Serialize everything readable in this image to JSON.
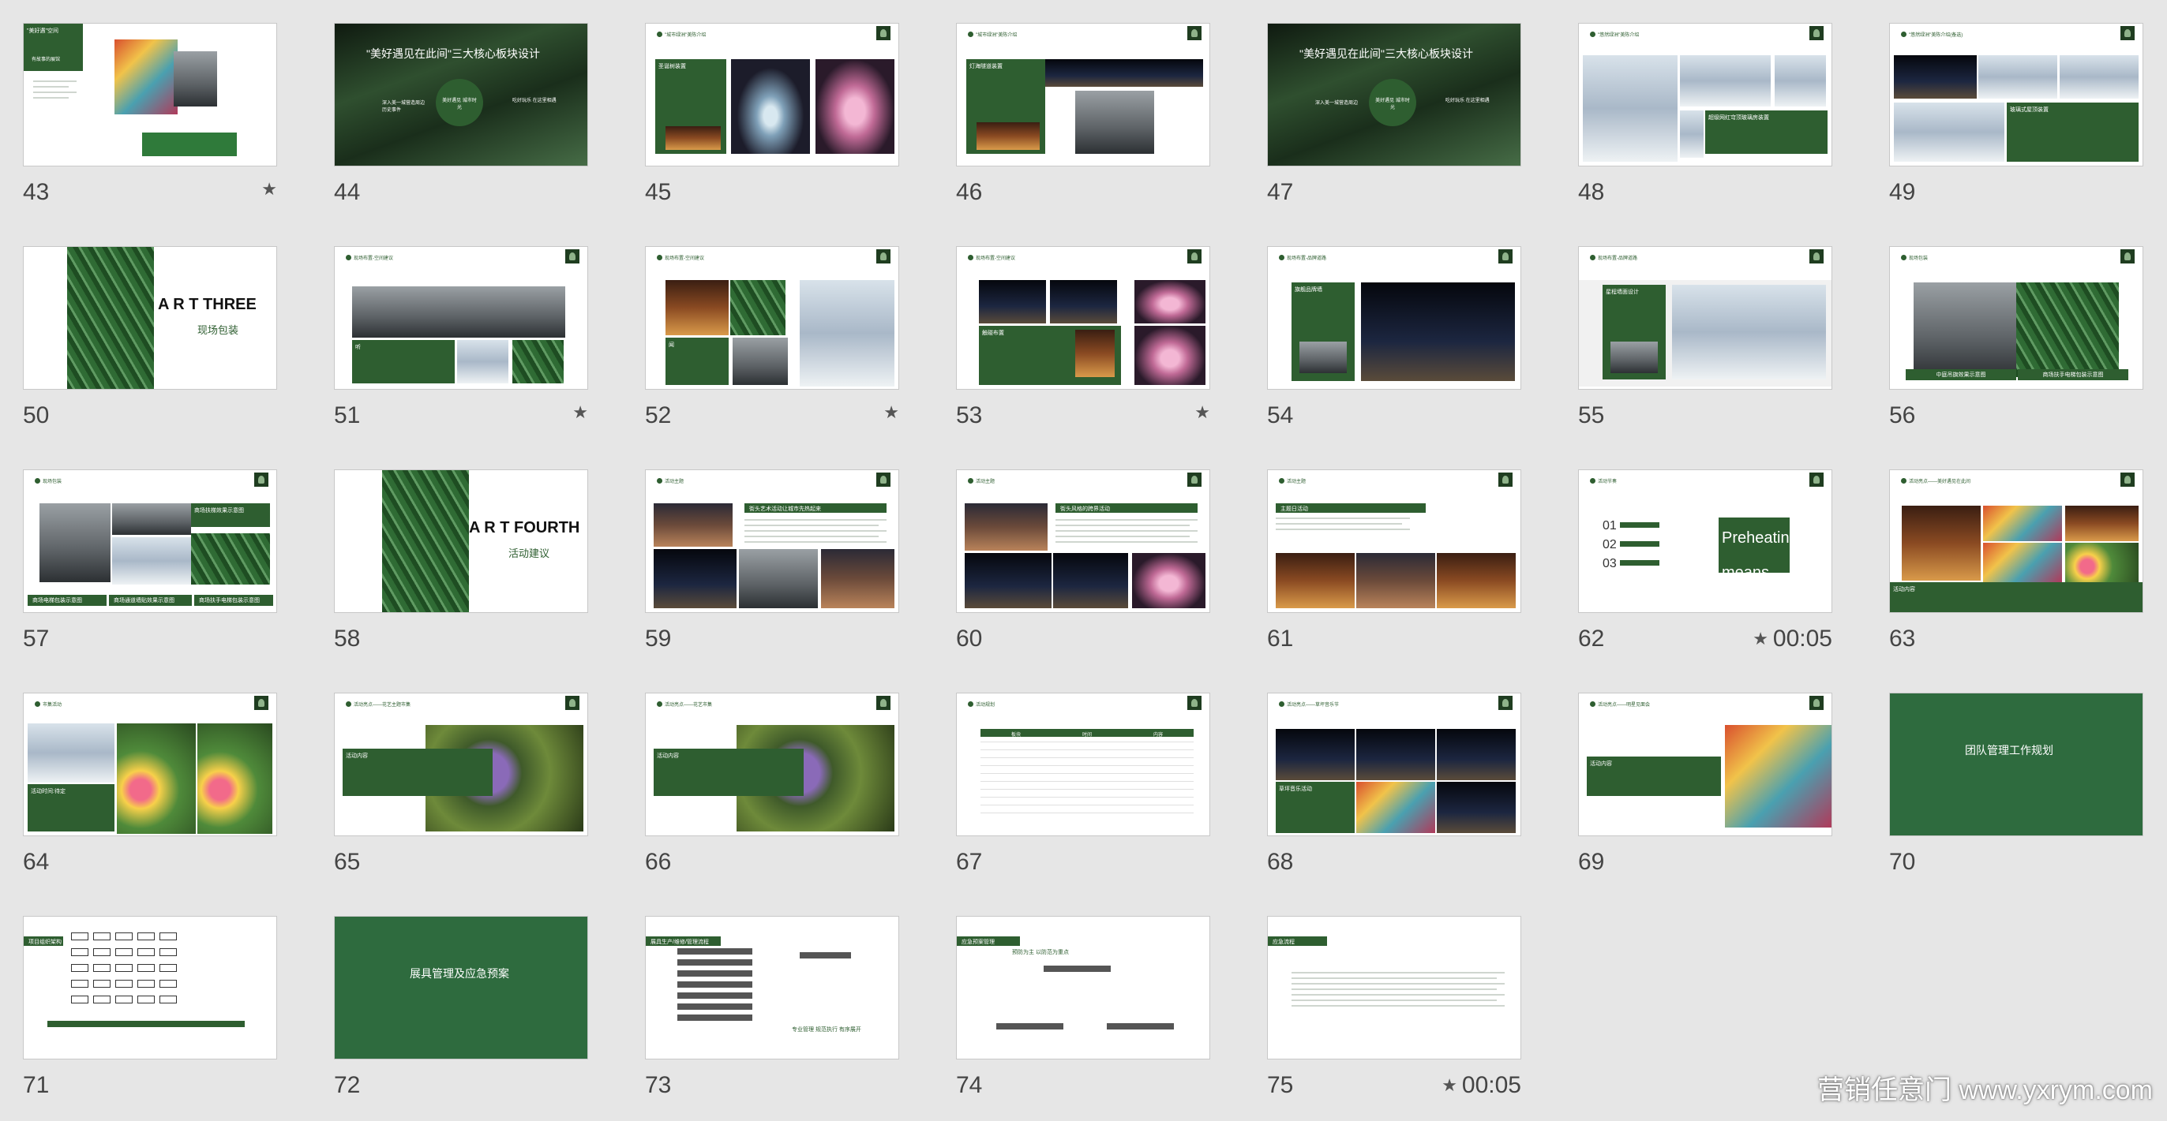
{
  "slides": [
    {
      "num": "43",
      "starred": true,
      "timing": "",
      "box": "\"美好遇\"空间",
      "sub": "有故事的展馆"
    },
    {
      "num": "44",
      "starred": false,
      "timing": "",
      "title": "\"美好遇见在此间\"三大核心板块设计",
      "circle": "美好遇见 城市时光",
      "left": "深入美一城营造周边 历史事件",
      "right": "吃好玩乐 在这里相遇"
    },
    {
      "num": "45",
      "starred": false,
      "timing": "",
      "header": "\"城市绿洲\"美陈介绍",
      "box": "圣诞树装置"
    },
    {
      "num": "46",
      "starred": false,
      "timing": "",
      "header": "\"城市绿洲\"美陈介绍",
      "box": "灯海隧道装置"
    },
    {
      "num": "47",
      "starred": false,
      "timing": "",
      "title": "\"美好遇见在此间\"三大核心板块设计",
      "circle": "美好遇见 城市时光",
      "left": "深入美一城营造周边",
      "right": "吃好玩乐 在这里相遇"
    },
    {
      "num": "48",
      "starred": false,
      "timing": "",
      "header": "\"悠然绿洲\"美陈介绍",
      "box": "超级网红穹顶玻璃房装置"
    },
    {
      "num": "49",
      "starred": false,
      "timing": "",
      "header": "\"悠然绿洲\"美陈介绍(备选)",
      "box": "玻璃式屋顶装置"
    },
    {
      "num": "50",
      "starred": false,
      "timing": "",
      "part": "A R T    THREE",
      "partsub": "现场包装"
    },
    {
      "num": "51",
      "starred": true,
      "timing": "",
      "header": "现场布置-空间建议",
      "box": "听"
    },
    {
      "num": "52",
      "starred": true,
      "timing": "",
      "header": "现场布置-空间建议",
      "box": "闻"
    },
    {
      "num": "53",
      "starred": true,
      "timing": "",
      "header": "现场布置-空间建议",
      "box": "触碰布置"
    },
    {
      "num": "54",
      "starred": false,
      "timing": "",
      "header": "现场布置-品牌道路",
      "box": "旗舰品牌墙"
    },
    {
      "num": "55",
      "starred": false,
      "timing": "",
      "header": "现场布置-品牌道路",
      "box": "星程墙面设计"
    },
    {
      "num": "56",
      "starred": false,
      "timing": "",
      "header": "现场包装",
      "bar1": "中庭吊旗效果示意图",
      "bar2": "商场扶手电梯包装示意图"
    },
    {
      "num": "57",
      "starred": false,
      "timing": "",
      "header": "现场包装",
      "bar1": "商场电梯包装示意图",
      "bar2": "商场通道墙贴效果示意图",
      "bar3": "商场扶手电梯包装示意图",
      "box": "商场扶梯效果示意图"
    },
    {
      "num": "58",
      "starred": false,
      "timing": "",
      "part": "A R T    FOURTH",
      "partsub": "活动建议"
    },
    {
      "num": "59",
      "starred": false,
      "timing": "",
      "header": "活动主题",
      "bar": "街头艺术活动让城市先热起来"
    },
    {
      "num": "60",
      "starred": false,
      "timing": "",
      "header": "活动主题",
      "bar": "街头风格的跨界活动"
    },
    {
      "num": "61",
      "starred": false,
      "timing": "",
      "header": "活动主题",
      "bar": "主题日活动"
    },
    {
      "num": "62",
      "starred": true,
      "timing": "00:05",
      "header": "活动节奏",
      "big": "Preheating means",
      "items": [
        "01",
        "02",
        "03"
      ]
    },
    {
      "num": "63",
      "starred": false,
      "timing": "",
      "header": "活动亮点——美好遇见在此间",
      "box": "活动内容"
    },
    {
      "num": "64",
      "starred": false,
      "timing": "",
      "header": "市集活动",
      "box": "活动时间:待定"
    },
    {
      "num": "65",
      "starred": false,
      "timing": "",
      "header": "活动亮点——花艺主题市集",
      "box": "活动内容"
    },
    {
      "num": "66",
      "starred": false,
      "timing": "",
      "header": "活动亮点——花艺市集",
      "box": "活动内容"
    },
    {
      "num": "67",
      "starred": false,
      "timing": "",
      "header": "活动规划",
      "cols": [
        "板块",
        "时间",
        "内容"
      ]
    },
    {
      "num": "68",
      "starred": false,
      "timing": "",
      "header": "活动亮点——草坪音乐节",
      "box": "草坪音乐活动"
    },
    {
      "num": "69",
      "starred": false,
      "timing": "",
      "header": "活动亮点——明星见面会",
      "box": "活动内容"
    },
    {
      "num": "70",
      "starred": false,
      "timing": "",
      "full": "团队管理工作规划"
    },
    {
      "num": "71",
      "starred": false,
      "timing": "",
      "bar": "项目组织架构"
    },
    {
      "num": "72",
      "starred": false,
      "timing": "",
      "full": "展具管理及应急预案"
    },
    {
      "num": "73",
      "starred": false,
      "timing": "",
      "bar": "展具生产/维修/管理流程",
      "note": "专业管理 规范执行 有序展开"
    },
    {
      "num": "74",
      "starred": false,
      "timing": "",
      "bar": "应急预案管理",
      "note": "预防为主 以防范为重点"
    },
    {
      "num": "75",
      "starred": true,
      "timing": "00:05",
      "bar": "应急流程"
    }
  ],
  "watermark": "营销任意门  www.yxrym.com",
  "colors": {
    "accent": "#2e5e30",
    "background": "#e6e6e6"
  },
  "icons": {
    "starred": "star-icon",
    "logo": "brand-logo-icon"
  }
}
